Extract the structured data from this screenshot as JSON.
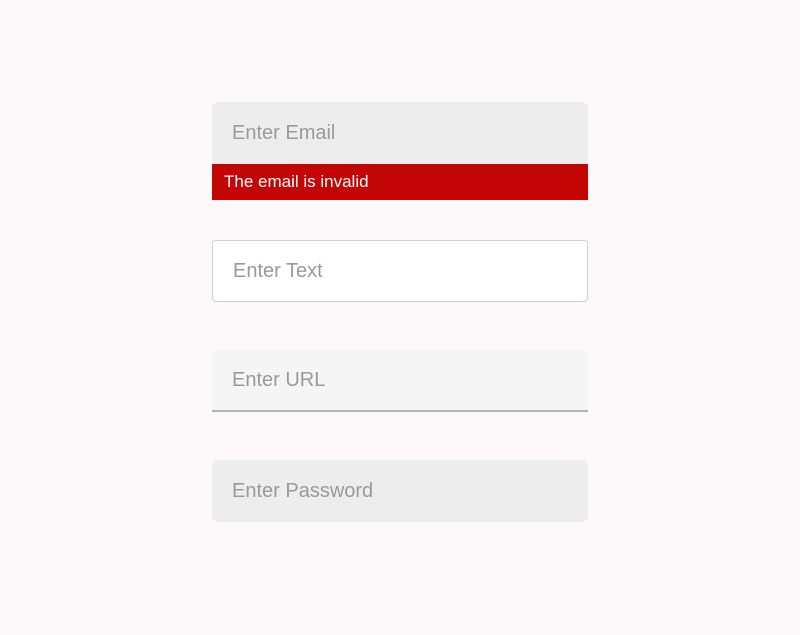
{
  "fields": {
    "email": {
      "placeholder": "Enter Email",
      "value": "",
      "error": "The email is invalid"
    },
    "text": {
      "placeholder": "Enter Text",
      "value": ""
    },
    "url": {
      "placeholder": "Enter URL",
      "value": ""
    },
    "password": {
      "placeholder": "Enter Password",
      "value": ""
    }
  }
}
